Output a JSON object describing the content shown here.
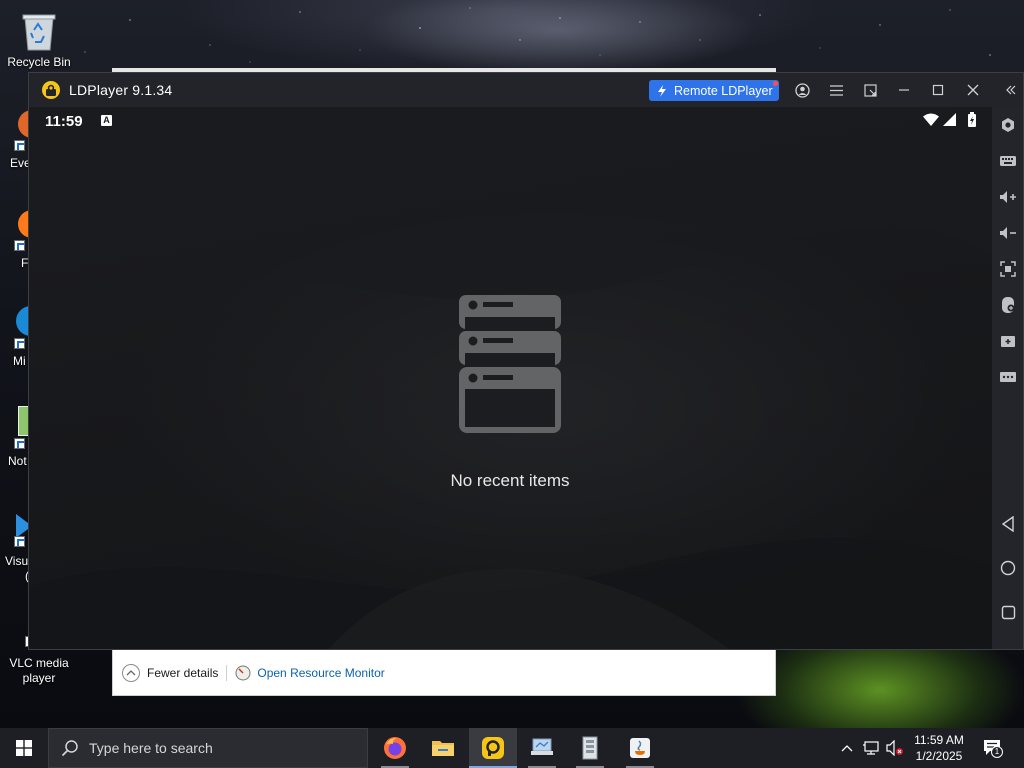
{
  "desktop": {
    "icons": [
      {
        "label": "Recycle Bin"
      },
      {
        "label": "VLC media player"
      }
    ],
    "partial_labels": [
      "Eve",
      "F",
      "Mi",
      "E",
      "Not",
      "Visu",
      "("
    ]
  },
  "ldplayer": {
    "title": "LDPlayer 9.1.34",
    "remote_button": "Remote LDPlayer",
    "android": {
      "time": "11:59",
      "status_letter": "A",
      "empty_message": "No recent items"
    }
  },
  "task_manager": {
    "fewer_details": "Fewer details",
    "open_resource_monitor": "Open Resource Monitor"
  },
  "taskbar": {
    "search_placeholder": "Type here to search",
    "time": "11:59 AM",
    "date": "1/2/2025",
    "notification_count": "1"
  },
  "colors": {
    "remote_button": "#2f73ea",
    "ld_logo": "#f5c518",
    "taskbar": "#1e1f24"
  }
}
